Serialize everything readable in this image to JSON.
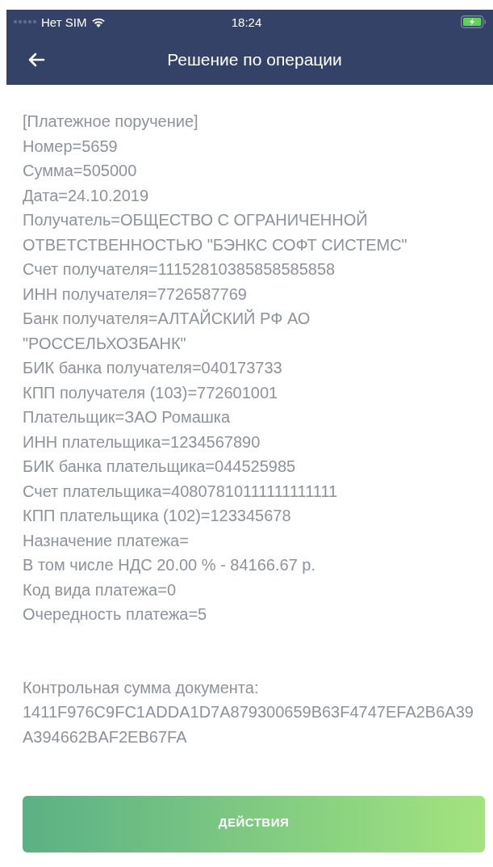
{
  "status_bar": {
    "carrier": "Нет SIM",
    "time": "18:24"
  },
  "nav": {
    "title": "Решение по операции"
  },
  "document": {
    "lines": [
      "[Платежное поручение]",
      "Номер=5659",
      "Сумма=505000",
      "Дата=24.10.2019",
      "Получатель=ОБЩЕСТВО С ОГРАНИЧЕННОЙ ОТВЕТСТВЕННОСТЬЮ \"БЭНКС СОФТ СИСТЕМС\"",
      "Счет получателя=11152810385858585858",
      "ИНН получателя=7726587769",
      "Банк получателя=АЛТАЙСКИЙ РФ АО \"РОССЕЛЬХОЗБАНК\"",
      "БИК банка получателя=040173733",
      "КПП получателя (103)=772601001",
      "Плательщик=ЗАО Ромашка",
      "ИНН плательщика=1234567890",
      "БИК банка плательщика=044525985",
      "Счет плательщика=40807810111111111111",
      "КПП плательщика (102)=123345678",
      "Назначение платежа=",
      "В том числе НДС 20.00 % - 84166.67 р.",
      "Код вида платежа=0",
      "Очередность платежа=5"
    ],
    "checksum_label": "Контрольная сумма документа:",
    "checksum": "1411F976C9FC1ADDA1D7A879300659B63F4747EFA2B6A39A394662BAF2EB67FA"
  },
  "action_button": "ДЕЙСТВИЯ"
}
